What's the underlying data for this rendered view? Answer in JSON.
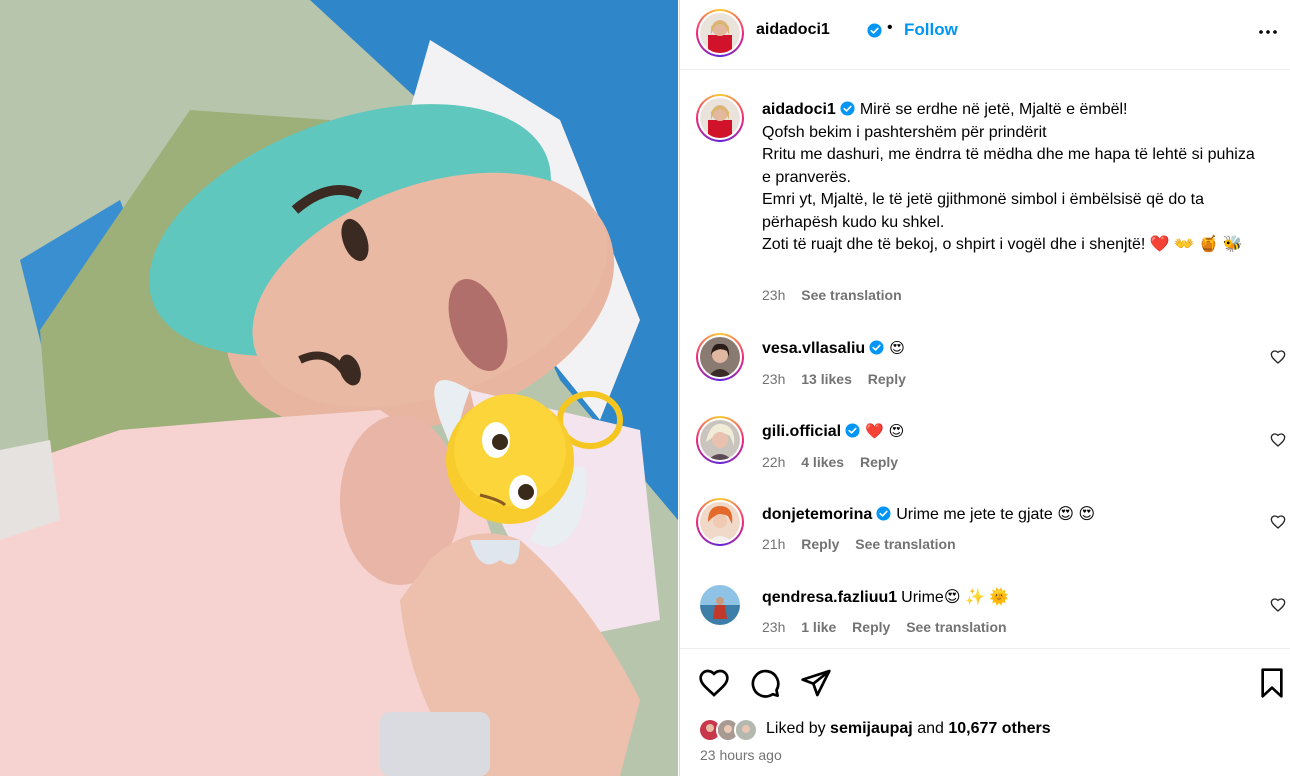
{
  "post": {
    "username": "aidadoci1",
    "follow_label": "Follow",
    "dot": "•"
  },
  "caption": {
    "username": "aidadoci1",
    "lines": [
      "Mirë se erdhe në jetë, Mjaltë e ëmbël!",
      "Qofsh bekim i pashtershëm për prindërit",
      "Rritu me dashuri, me ëndrra të mëdha dhe me hapa të lehtë si puhiza e pranverës.",
      "Emri yt, Mjaltë, le të jetë gjithmonë simbol i ëmbëlsisë që do ta përhapësh kudo ku shkel.",
      "Zoti të ruajt dhe të bekoj, o shpirt i vogël dhe i shenjtë! ❤️ 👐 🍯 🐝"
    ],
    "time": "23h",
    "see_translation": "See translation"
  },
  "comments": [
    {
      "username": "vesa.vllasaliu",
      "text": "😍",
      "time": "23h",
      "likes": "13 likes",
      "reply": "Reply",
      "see_translation": ""
    },
    {
      "username": "gili.official",
      "text": "❤️ 😍",
      "time": "22h",
      "likes": "4 likes",
      "reply": "Reply",
      "see_translation": ""
    },
    {
      "username": "donjetemorina",
      "text": "Urime me jete te gjate 😍 😍",
      "time": "21h",
      "likes": "",
      "reply": "Reply",
      "see_translation": "See translation"
    },
    {
      "username": "qendresa.fazliuu1",
      "text": "Urime😍 ✨ 🌞",
      "time": "23h",
      "likes": "1 like",
      "reply": "Reply",
      "see_translation": "See translation"
    }
  ],
  "footer": {
    "liked_by_prefix": "Liked by",
    "liked_by_user": "semijaupaj",
    "liked_by_and": "and",
    "liked_by_count": "10,677 others",
    "time_ago": "23 hours ago"
  },
  "colors": {
    "accent": "#0095f6",
    "muted": "#737373",
    "verified": "#0095f6"
  }
}
